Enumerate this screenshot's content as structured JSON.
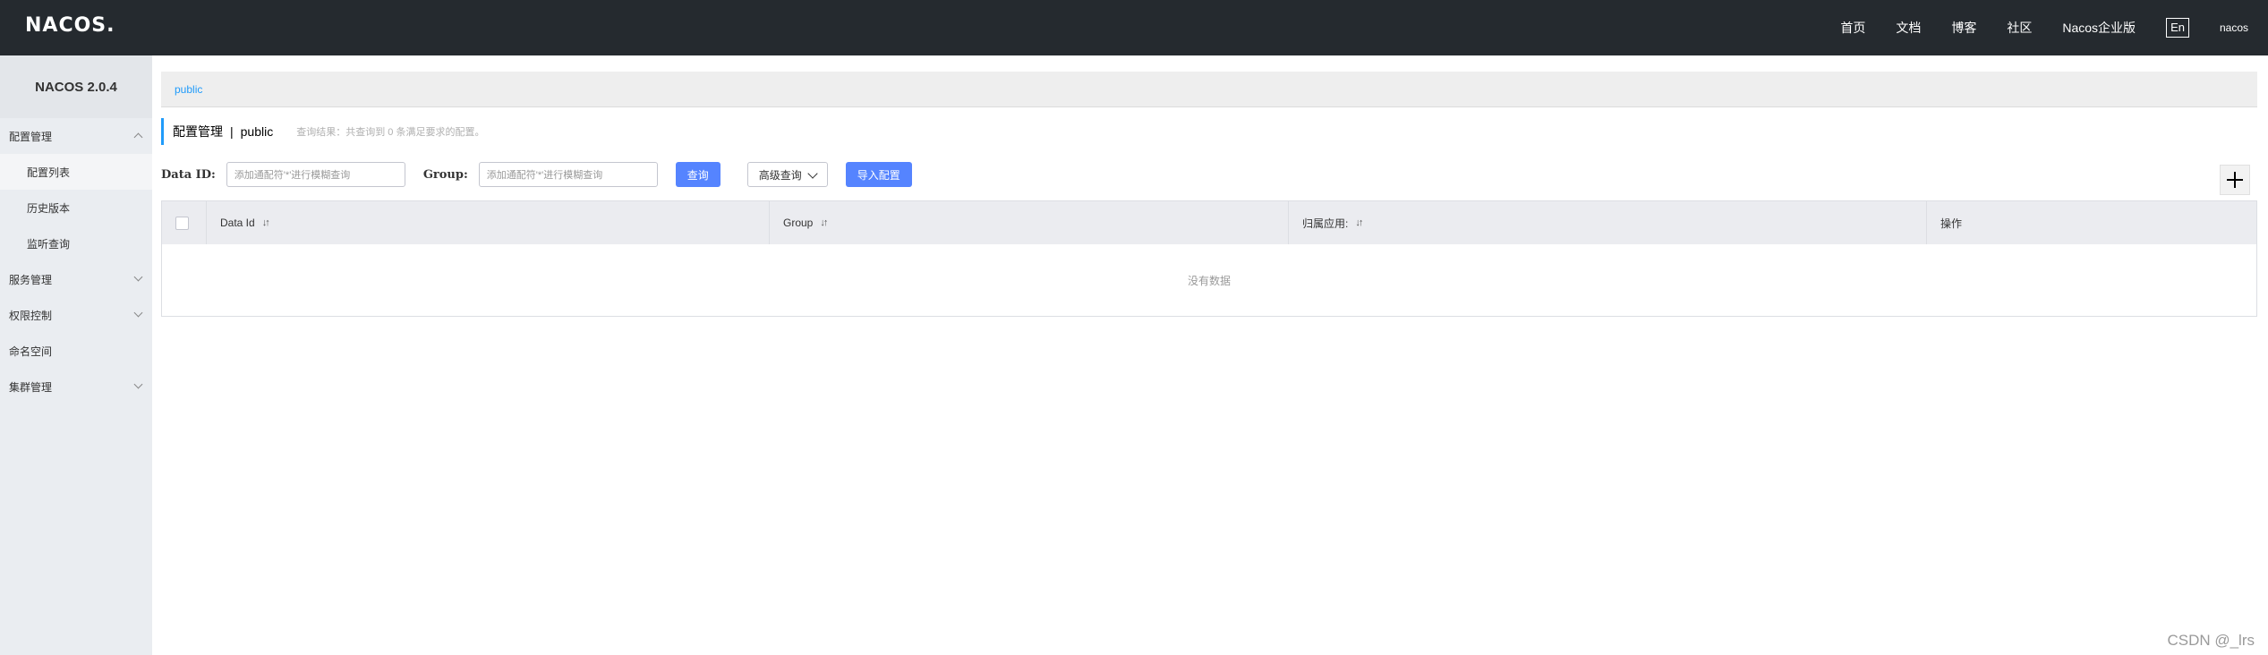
{
  "header": {
    "logo": "NACOS.",
    "nav": [
      "首页",
      "文档",
      "博客",
      "社区",
      "Nacos企业版"
    ],
    "lang": "En",
    "user": "nacos"
  },
  "sidebar": {
    "version": "NACOS 2.0.4",
    "groups": [
      {
        "label": "配置管理",
        "expanded": true,
        "items": [
          "配置列表",
          "历史版本",
          "监听查询"
        ]
      },
      {
        "label": "服务管理",
        "expanded": false
      },
      {
        "label": "权限控制",
        "expanded": false
      },
      {
        "label": "命名空间"
      },
      {
        "label": "集群管理",
        "expanded": false
      }
    ]
  },
  "main": {
    "breadcrumb": "public",
    "title": "配置管理",
    "separator": "|",
    "namespace": "public",
    "hint": "查询结果：共查询到 0 条满足要求的配置。",
    "search": {
      "data_id_label": "Data ID:",
      "data_id_placeholder": "添加通配符'*'进行模糊查询",
      "group_label": "Group:",
      "group_placeholder": "添加通配符'*'进行模糊查询",
      "query_button": "查询",
      "advanced_button": "高级查询",
      "import_button": "导入配置"
    },
    "table": {
      "columns": [
        "Data Id",
        "Group",
        "归属应用:",
        "操作"
      ],
      "empty_text": "没有数据"
    }
  },
  "watermark": "CSDN @_lrs",
  "colors": {
    "topbar": "#252a2f",
    "primary": "#5584ff",
    "link": "#209bfa",
    "sidebar": "#eaedf1"
  }
}
